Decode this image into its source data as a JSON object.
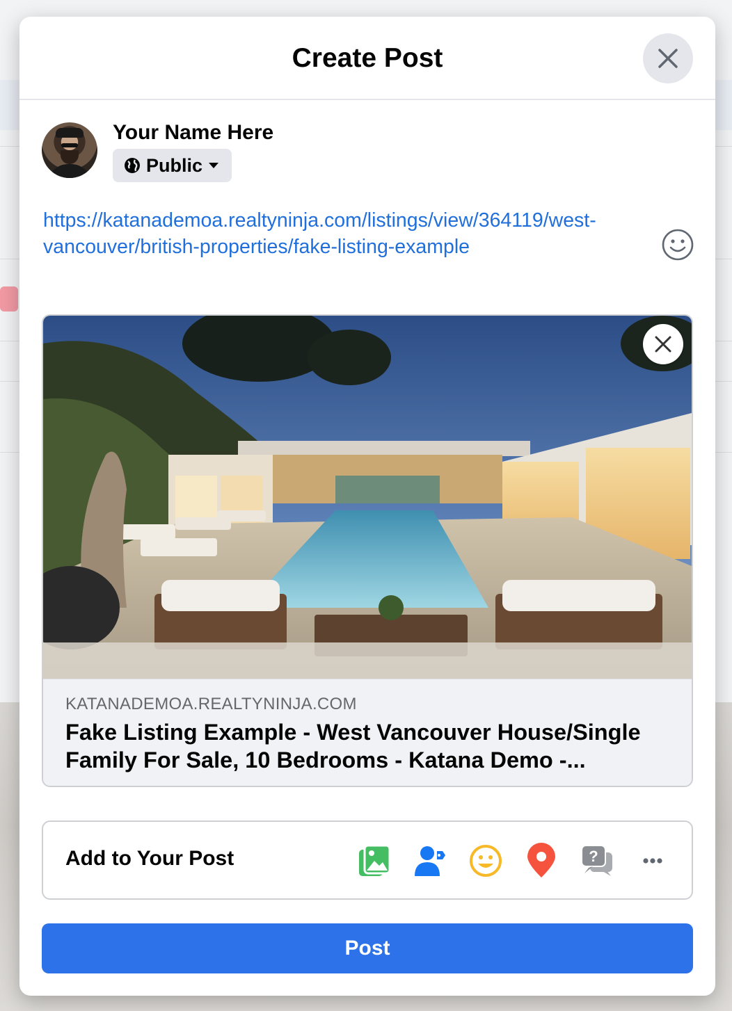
{
  "modal": {
    "title": "Create Post",
    "user": {
      "name": "Your Name Here",
      "privacy": "Public"
    },
    "post_text": "https://katanademoa.realtyninja.com/listings/view/364119/west-vancouver/british-properties/fake-listing-example",
    "link_preview": {
      "domain": "KATANADEMOA.REALTYNINJA.COM",
      "title": "Fake Listing Example - West Vancouver House/Single Family For Sale, 10 Bedrooms - Katana Demo -..."
    },
    "add_to_post": {
      "label": "Add to Your Post",
      "icons": [
        "photo-video-icon",
        "tag-people-icon",
        "feeling-icon",
        "check-in-icon",
        "ask-recommendations-icon",
        "more-icon"
      ],
      "colors": {
        "photo": "#45bd62",
        "tag": "#1877f2",
        "feeling": "#f7b928",
        "checkin": "#f5533d",
        "ask": "#8a8d91"
      }
    },
    "post_button": "Post"
  },
  "accent_color": "#2d72e8"
}
